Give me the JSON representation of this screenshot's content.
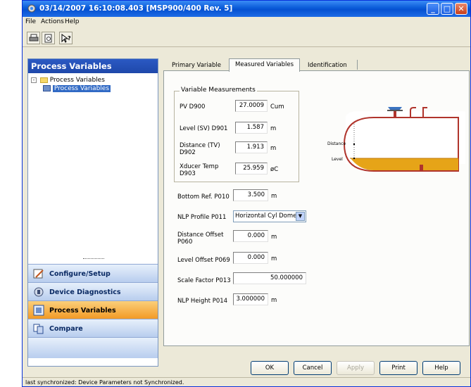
{
  "window": {
    "title": "03/14/2007 16:10:08.403 [MSP900/400 Rev. 5]",
    "minimize": "_",
    "maximize": "□",
    "close": "✕"
  },
  "menu": {
    "file": "File",
    "actions": "Actions",
    "help": "Help"
  },
  "toolbar": {
    "print_icon": "printer-icon",
    "preview_icon": "print-preview-icon",
    "help_icon": "context-help-icon"
  },
  "left_panel": {
    "header": "Process Variables",
    "tree": {
      "root": "Process Variables",
      "child": "Process Variables"
    },
    "nav": [
      "Configure/Setup",
      "Device Diagnostics",
      "Process Variables",
      "Compare"
    ],
    "active_nav": "Process Variables"
  },
  "tabs": [
    "Primary Variable",
    "Measured Variables",
    "Identification"
  ],
  "active_tab": "Measured Variables",
  "group": {
    "title": "Variable Measurements",
    "rows": [
      {
        "label": "PV D900",
        "value": "27.0009",
        "unit": "Cum"
      },
      {
        "label": "Level (SV) D901",
        "value": "1.587",
        "unit": "m"
      },
      {
        "label": "Distance (TV)\nD902",
        "value": "1.913",
        "unit": "m"
      },
      {
        "label": "Xducer Temp\nD903",
        "value": "25.959",
        "unit": "øC"
      }
    ]
  },
  "params": [
    {
      "label": "Bottom Ref. P010",
      "value": "3.500",
      "unit": "m"
    },
    {
      "label": "NLP Profile P011",
      "value": "Horizontal Cyl Domed",
      "unit": ""
    },
    {
      "label": "Distance Offset\nP060",
      "value": "0.000",
      "unit": "m"
    },
    {
      "label": "Level Offset P069",
      "value": "0.000",
      "unit": "m"
    },
    {
      "label": "Scale Factor P013",
      "value": "50.000000",
      "unit": ""
    },
    {
      "label": "NLP Height P014",
      "value": "3.000000",
      "unit": "m"
    }
  ],
  "diagram": {
    "distance_label": "Distance",
    "level_label": "Level",
    "liquid_color": "#e6a418",
    "tank_color": "#b0342c"
  },
  "buttons": {
    "ok": "OK",
    "cancel": "Cancel",
    "apply": "Apply",
    "print": "Print",
    "help": "Help"
  },
  "status": "last synchronized: Device Parameters not Synchronized."
}
